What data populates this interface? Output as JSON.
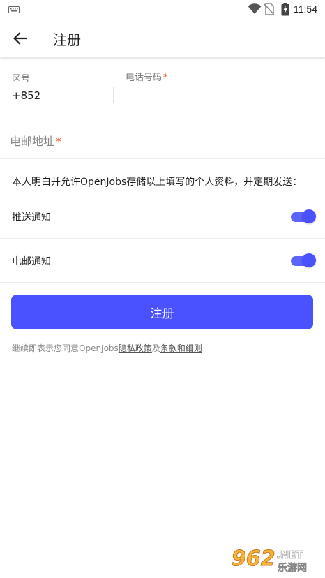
{
  "status_bar": {
    "time": "11:54",
    "icons": [
      "keyboard-icon",
      "wifi-icon",
      "no-sim-icon",
      "battery-icon"
    ]
  },
  "app_bar": {
    "title": "注册",
    "back_icon": "arrow-left-icon"
  },
  "phone": {
    "region_label": "区号",
    "region_value": "+852",
    "phone_label": "电话号码",
    "required_mark": "*"
  },
  "email": {
    "label": "电邮地址",
    "required_mark": "*"
  },
  "consent": {
    "text": "本人明白并允许OpenJobs存储以上填写的个人资料，并定期发送："
  },
  "toggles": [
    {
      "label": "推送通知",
      "on": true
    },
    {
      "label": "电邮通知",
      "on": true
    }
  ],
  "register_button": {
    "label": "注册"
  },
  "terms": {
    "prefix": "继续即表示您同意OpenJobs",
    "privacy_link": "隐私政策",
    "middle": "及",
    "terms_link": "条款和细则"
  },
  "watermark": {
    "number": "962",
    "suffix": ".NET",
    "sub": "乐游网"
  },
  "colors": {
    "accent": "#4a52ff",
    "required": "#e4572e"
  }
}
